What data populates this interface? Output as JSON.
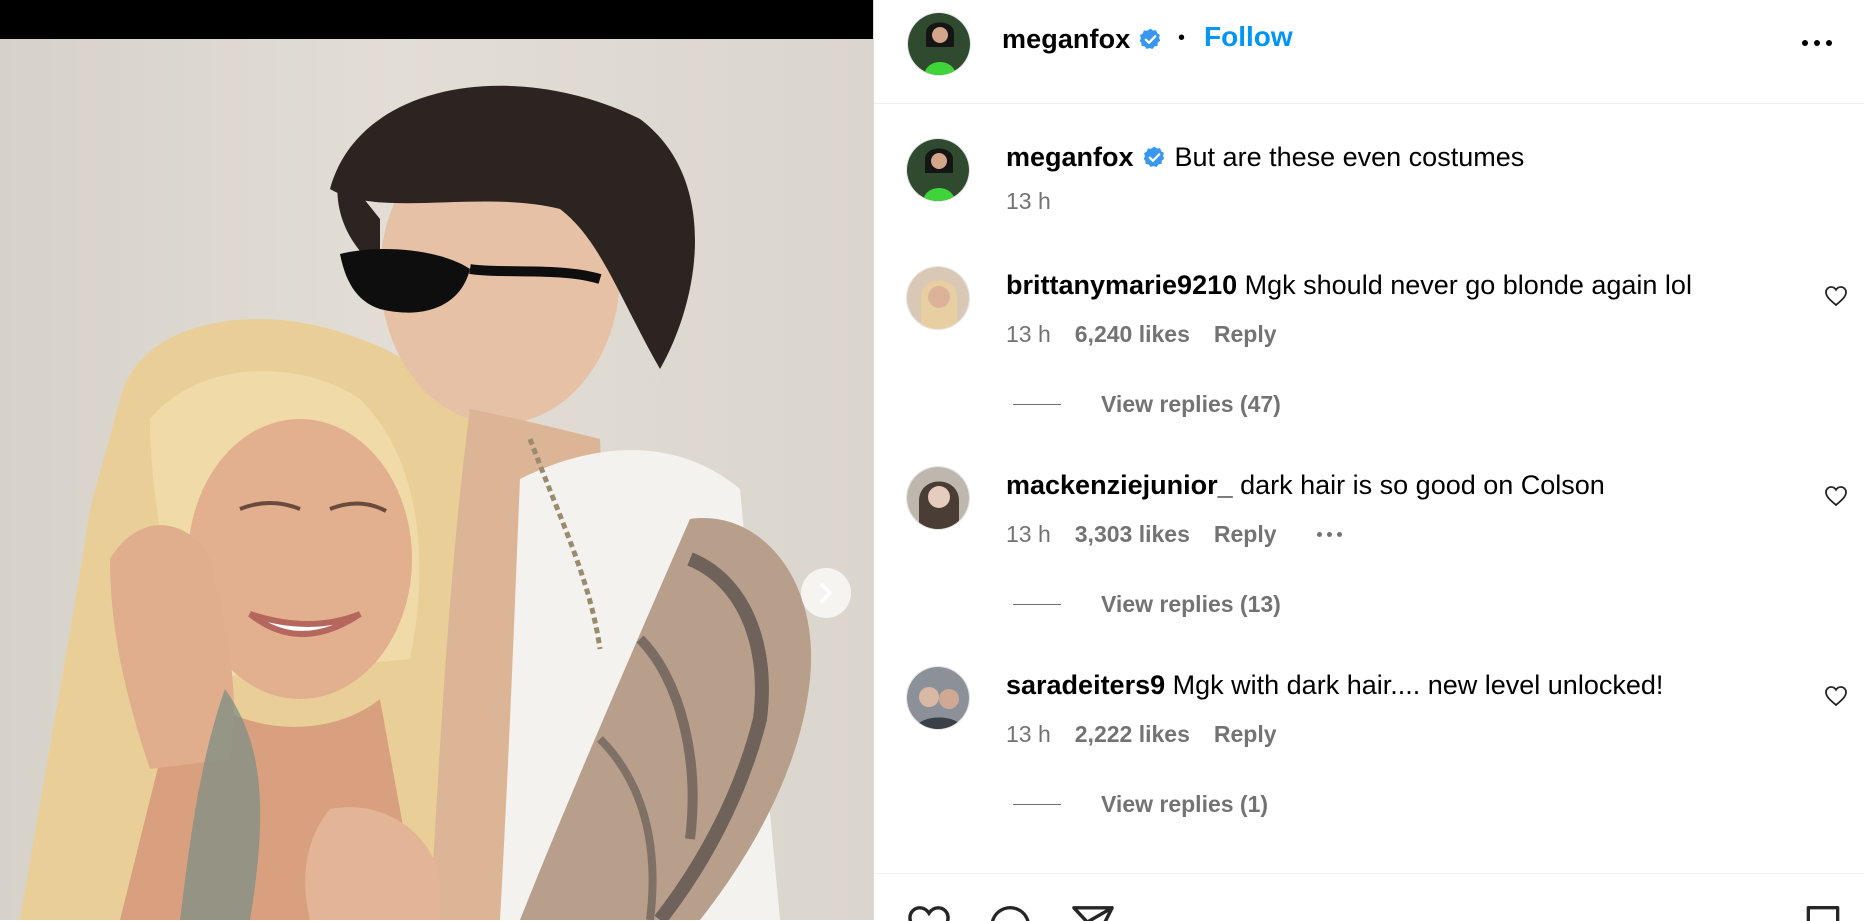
{
  "post": {
    "username": "meganfox",
    "follow_label": "Follow",
    "separator": "•",
    "caption": "But are these even costumes",
    "caption_time": "13 h"
  },
  "comments": [
    {
      "username": "brittanymarie9210",
      "text": "Mgk should never go blonde again lol",
      "time": "13 h",
      "likes": "6,240 likes",
      "reply_label": "Reply",
      "view_replies": "View replies (47)"
    },
    {
      "username": "mackenziejunior_",
      "text": "dark hair is so good on Colson",
      "time": "13 h",
      "likes": "3,303 likes",
      "reply_label": "Reply",
      "view_replies": "View replies (13)"
    },
    {
      "username": "saradeiters9",
      "text": "Mgk with dark hair.... new level unlocked!",
      "time": "13 h",
      "likes": "2,222 likes",
      "reply_label": "Reply",
      "view_replies": "View replies (1)"
    }
  ],
  "icons": {
    "verified": "verified-badge-icon",
    "more": "more-options-icon",
    "next": "chevron-right-icon",
    "like": "heart-icon",
    "comment": "comment-icon",
    "share": "share-icon",
    "save": "bookmark-icon"
  },
  "colors": {
    "accent": "#0095f6",
    "secondary_text": "#737373",
    "verified": "#3897f0"
  }
}
